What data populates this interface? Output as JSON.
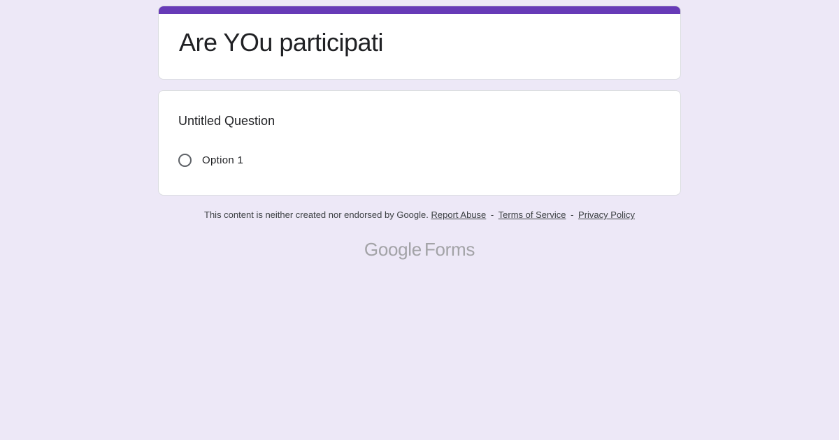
{
  "colors": {
    "background": "#ede8f7",
    "accent": "#673ab7",
    "card": "#ffffff"
  },
  "form": {
    "title": "Are YOu participati"
  },
  "question": {
    "title": "Untitled Question",
    "options": [
      "Option 1"
    ]
  },
  "footer": {
    "disclaimer": "This content is neither created nor endorsed by Google.",
    "report_abuse": "Report Abuse",
    "sep1": "-",
    "terms": "Terms of Service",
    "sep2": "-",
    "privacy": "Privacy Policy"
  },
  "brand": {
    "google": "Google",
    "forms": "Forms"
  }
}
